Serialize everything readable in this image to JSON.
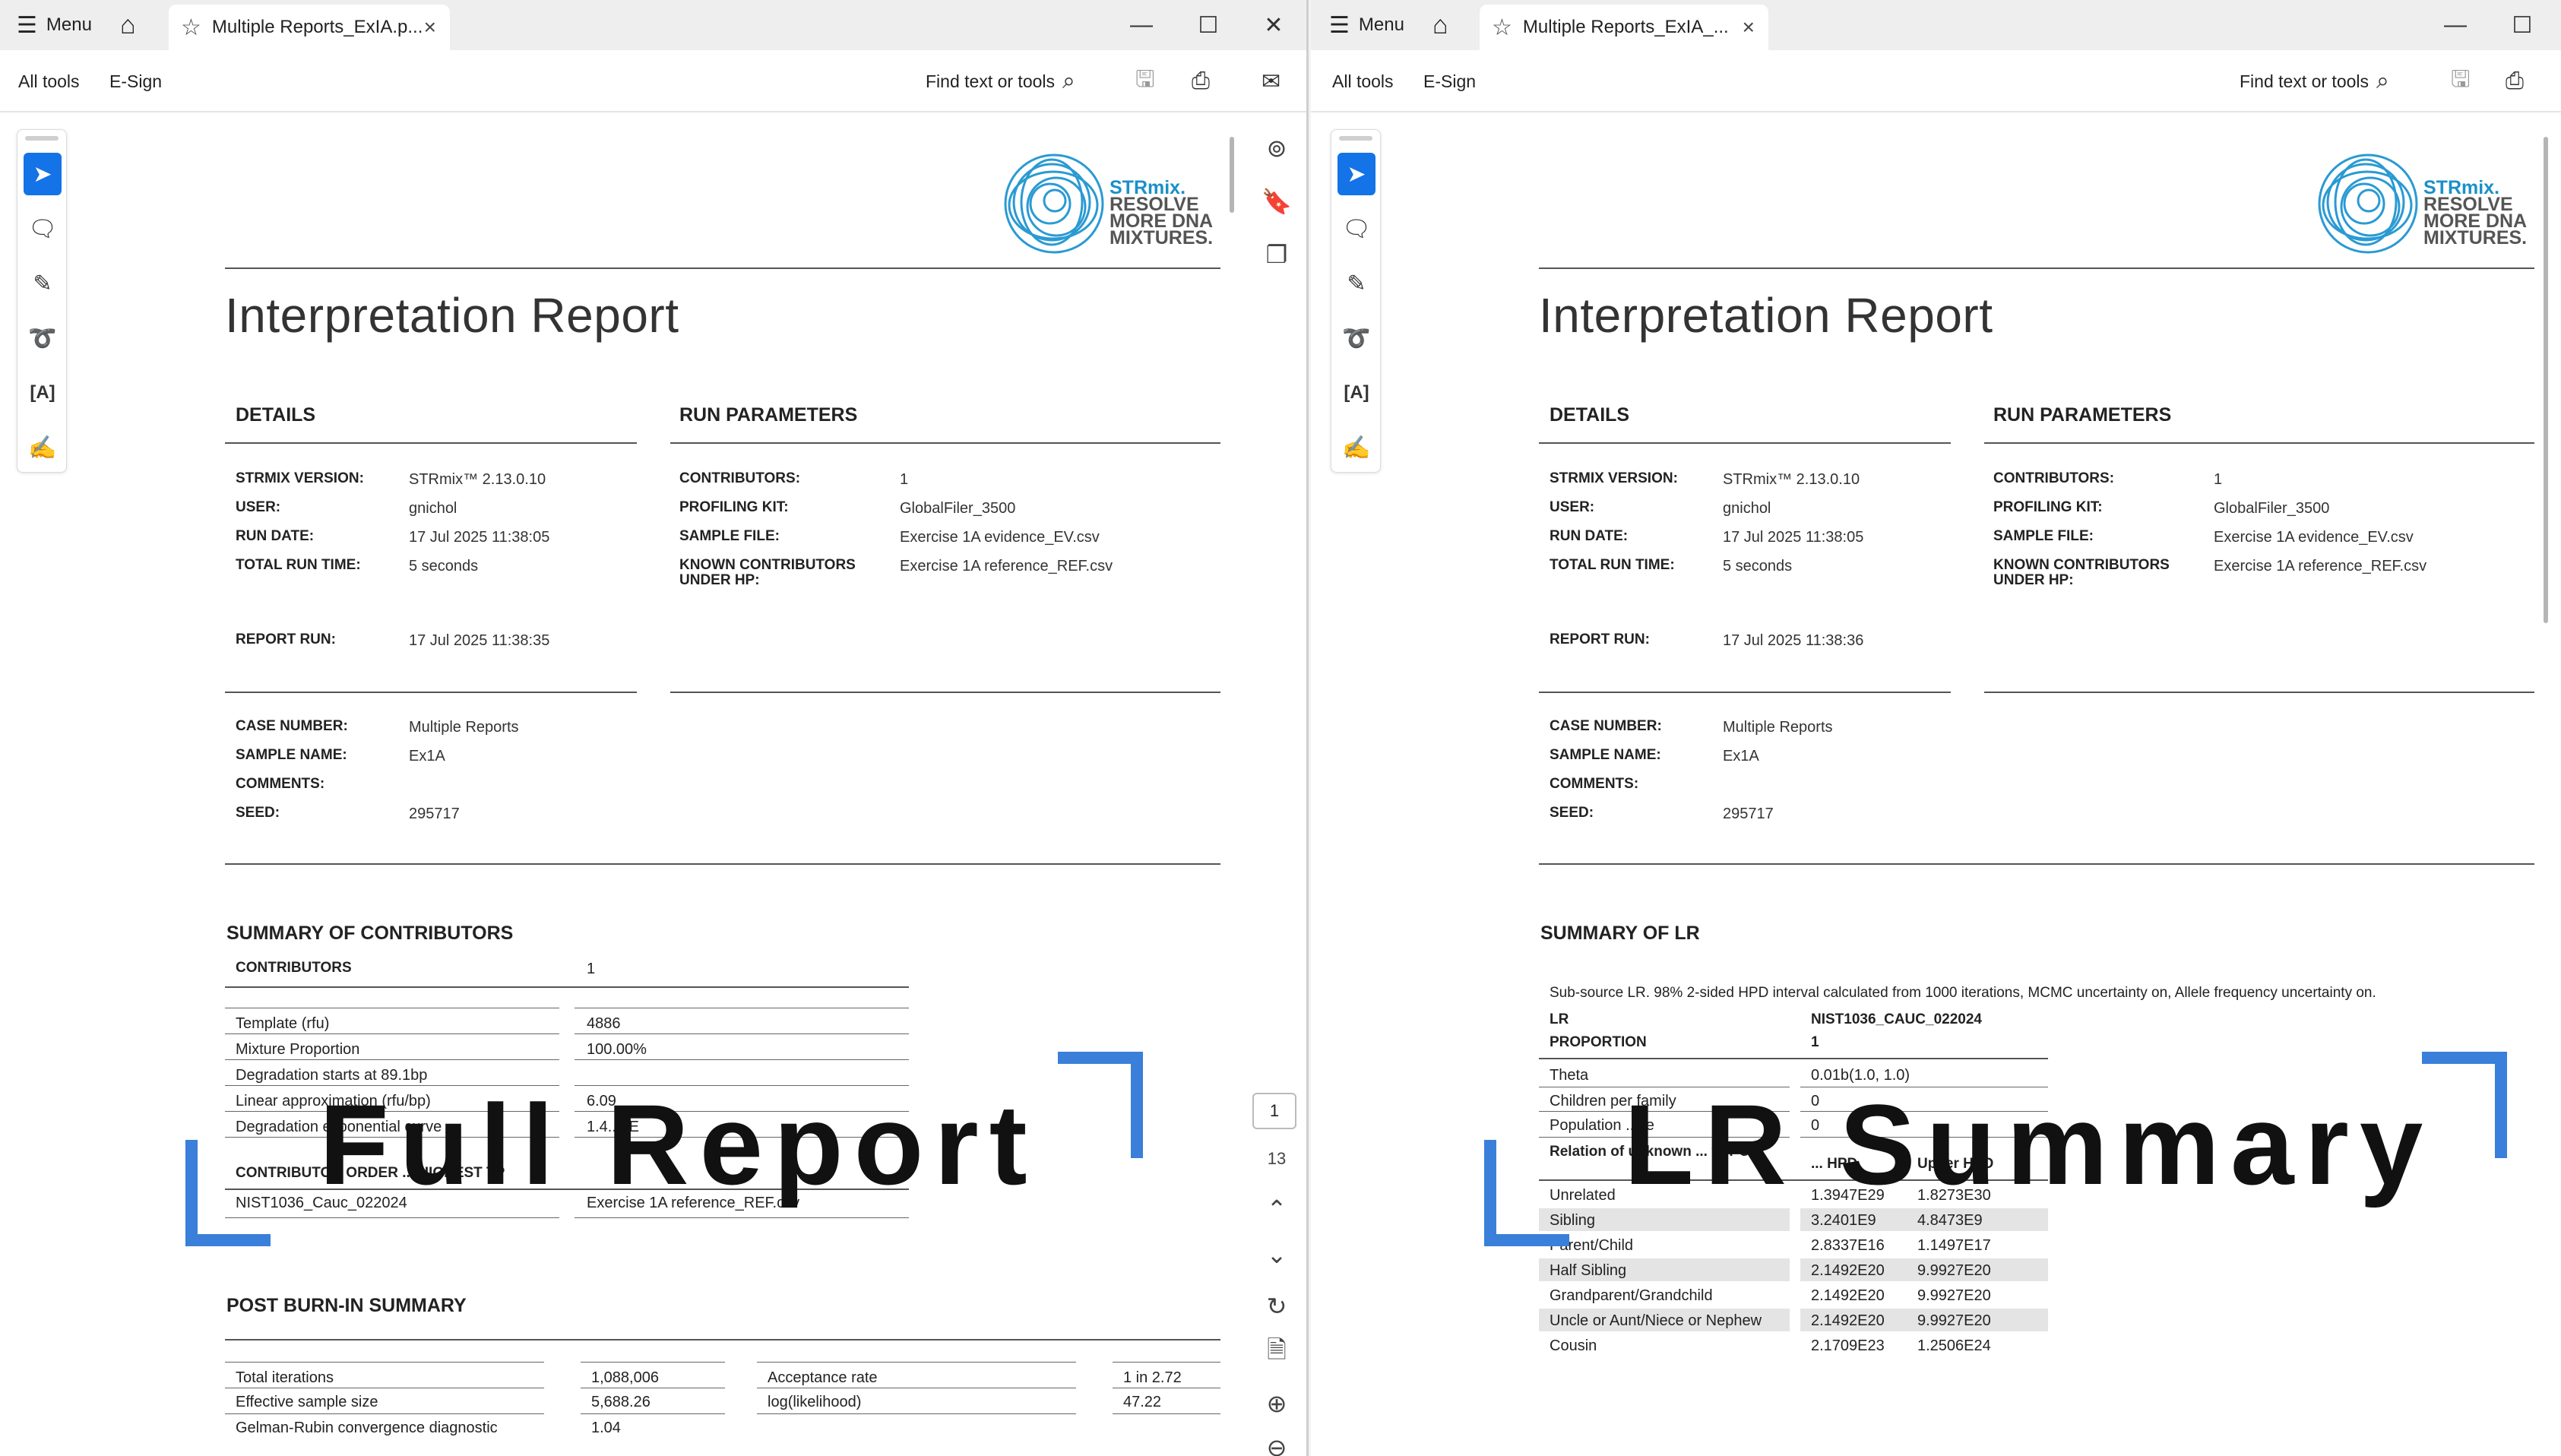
{
  "left": {
    "titlebar": {
      "menu": "Menu",
      "tab_title": "Multiple Reports_ExIA.p...",
      "close": "×",
      "minimize": "—",
      "maximize": "☐",
      "window_close": "✕"
    },
    "toolbar": {
      "all_tools": "All tools",
      "esign": "E-Sign",
      "find": "Find text or tools"
    },
    "logo": {
      "line1": "STRmix.",
      "line2": "RESOLVE",
      "line3": "MORE DNA",
      "line4": "MIXTURES."
    },
    "title": "Interpretation Report",
    "details": {
      "heading": "DETAILS",
      "rows": [
        {
          "label": "STRMIX VERSION:",
          "value": "STRmix™ 2.13.0.10"
        },
        {
          "label": "USER:",
          "value": "gnichol"
        },
        {
          "label": "RUN DATE:",
          "value": "17 Jul 2025  11:38:05"
        },
        {
          "label": "TOTAL RUN TIME:",
          "value": "5 seconds"
        }
      ],
      "report_run_label": "REPORT RUN:",
      "report_run_value": "17 Jul 2025  11:38:35"
    },
    "run_params": {
      "heading": "RUN PARAMETERS",
      "rows": [
        {
          "label": "CONTRIBUTORS:",
          "value": "1"
        },
        {
          "label": "PROFILING KIT:",
          "value": "GlobalFiler_3500"
        },
        {
          "label": "SAMPLE FILE:",
          "value": "Exercise 1A evidence_EV.csv"
        },
        {
          "label": "KNOWN CONTRIBUTORS UNDER HP:",
          "value": "Exercise 1A reference_REF.csv"
        }
      ]
    },
    "case": [
      {
        "label": "CASE NUMBER:",
        "value": "Multiple Reports"
      },
      {
        "label": "SAMPLE NAME:",
        "value": "Ex1A"
      },
      {
        "label": "COMMENTS:",
        "value": ""
      },
      {
        "label": "SEED:",
        "value": "295717"
      }
    ],
    "summary_contributors": {
      "heading": "SUMMARY OF CONTRIBUTORS",
      "contributors_label": "CONTRIBUTORS",
      "contributors_value": "1",
      "rows": [
        {
          "label": "Template (rfu)",
          "value": "4886"
        },
        {
          "label": "Mixture Proportion",
          "value": "100.00%"
        },
        {
          "label": "Degradation starts at 89.1bp",
          "value": ""
        },
        {
          "label": "Linear approximation (rfu/bp)",
          "value": "6.09"
        },
        {
          "label": "Degradation exponential curve",
          "value": "1.4...5E"
        }
      ],
      "order_label": "CONTRIBUTOR ORDER ... HIGHEST TP",
      "order_row": {
        "label": "NIST1036_Cauc_022024",
        "value": "Exercise 1A reference_REF.csv"
      }
    },
    "post_burn": {
      "heading": "POST BURN-IN SUMMARY",
      "rows": [
        {
          "label": "Total iterations",
          "value": "1,088,006",
          "label2": "Acceptance rate",
          "value2": "1 in 2.72"
        },
        {
          "label": "Effective sample size",
          "value": "5,688.26",
          "label2": "log(likelihood)",
          "value2": "47.22"
        },
        {
          "label": "Gelman-Rubin convergence diagnostic",
          "value": "1.04",
          "label2": "",
          "value2": ""
        }
      ]
    },
    "overlay": "Full Report",
    "page": {
      "current": "1",
      "total": "13"
    }
  },
  "right": {
    "titlebar": {
      "menu": "Menu",
      "tab_title": "Multiple Reports_ExIA_...",
      "close": "×",
      "minimize": "—",
      "maximize": "☐"
    },
    "toolbar": {
      "all_tools": "All tools",
      "esign": "E-Sign",
      "find": "Find text or tools"
    },
    "logo": {
      "line1": "STRmix.",
      "line2": "RESOLVE",
      "line3": "MORE DNA",
      "line4": "MIXTURES."
    },
    "title": "Interpretation Report",
    "details": {
      "heading": "DETAILS",
      "rows": [
        {
          "label": "STRMIX VERSION:",
          "value": "STRmix™ 2.13.0.10"
        },
        {
          "label": "USER:",
          "value": "gnichol"
        },
        {
          "label": "RUN DATE:",
          "value": "17 Jul 2025  11:38:05"
        },
        {
          "label": "TOTAL RUN TIME:",
          "value": "5 seconds"
        }
      ],
      "report_run_label": "REPORT RUN:",
      "report_run_value": "17 Jul 2025  11:38:36"
    },
    "run_params": {
      "heading": "RUN PARAMETERS",
      "rows": [
        {
          "label": "CONTRIBUTORS:",
          "value": "1"
        },
        {
          "label": "PROFILING KIT:",
          "value": "GlobalFiler_3500"
        },
        {
          "label": "SAMPLE FILE:",
          "value": "Exercise 1A evidence_EV.csv"
        },
        {
          "label": "KNOWN CONTRIBUTORS UNDER HP:",
          "value": "Exercise 1A reference_REF.csv"
        }
      ]
    },
    "case": [
      {
        "label": "CASE NUMBER:",
        "value": "Multiple Reports"
      },
      {
        "label": "SAMPLE NAME:",
        "value": "Ex1A"
      },
      {
        "label": "COMMENTS:",
        "value": ""
      },
      {
        "label": "SEED:",
        "value": "295717"
      }
    ],
    "summary_lr": {
      "heading": "SUMMARY OF LR",
      "note": "Sub-source LR.  98% 2-sided HPD interval calculated from 1000 iterations, MCMC uncertainty on, Allele frequency uncertainty on.",
      "lr_label": "LR",
      "lr_value": "NIST1036_CAUC_022024",
      "prop_label": "PROPORTION",
      "prop_value": "1",
      "params": [
        {
          "label": "Theta",
          "value": "0.01b(1.0, 1.0)"
        },
        {
          "label": "Children per family",
          "value": "0"
        },
        {
          "label": "Population ...ze",
          "value": "0"
        }
      ],
      "rel_header": "Relation of unknown ... to POI",
      "col_low": "... HPD",
      "col_up": "Upper HPD",
      "rows": [
        {
          "label": "Unrelated",
          "low": "1.3947E29",
          "up": "1.8273E30",
          "shade": false
        },
        {
          "label": "Sibling",
          "low": "3.2401E9",
          "up": "4.8473E9",
          "shade": true
        },
        {
          "label": "Parent/Child",
          "low": "2.8337E16",
          "up": "1.1497E17",
          "shade": false
        },
        {
          "label": "Half Sibling",
          "low": "2.1492E20",
          "up": "9.9927E20",
          "shade": true
        },
        {
          "label": "Grandparent/Grandchild",
          "low": "2.1492E20",
          "up": "9.9927E20",
          "shade": false
        },
        {
          "label": "Uncle or Aunt/Niece or Nephew",
          "low": "2.1492E20",
          "up": "9.9927E20",
          "shade": true
        },
        {
          "label": "Cousin",
          "low": "2.1709E23",
          "up": "1.2506E24",
          "shade": false
        }
      ]
    },
    "overlay": "LR Summary"
  },
  "colors": {
    "accent": "#1473e6",
    "bracket": "#3a7fd9",
    "logo": "#1a90c8"
  }
}
